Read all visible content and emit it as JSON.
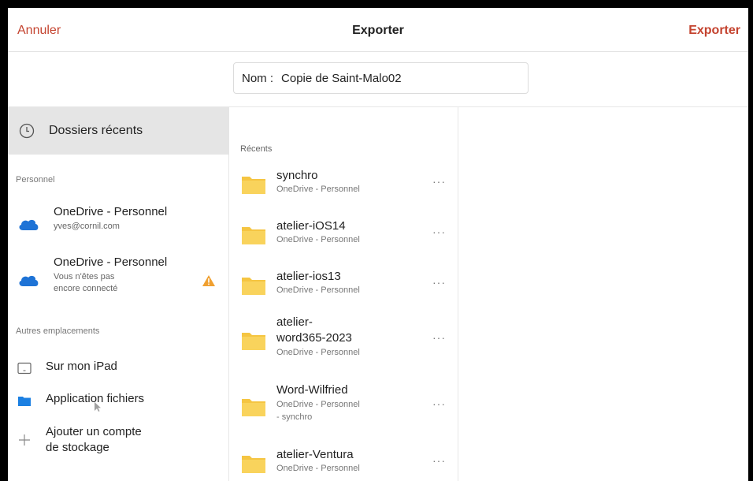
{
  "header": {
    "cancel_label": "Annuler",
    "title": "Exporter",
    "export_label": "Exporter"
  },
  "name_field": {
    "label": "Nom :",
    "value": "Copie de Saint-Malo02"
  },
  "sidebar": {
    "recent_label": "Dossiers récents",
    "personal_section": "Personnel",
    "accounts": [
      {
        "title": "OneDrive - Personnel",
        "subtitle": "yves@cornil.com",
        "icon": "onedrive-cloud-icon"
      },
      {
        "title": "OneDrive - Personnel",
        "subtitle_line1": "Vous n'êtes pas",
        "subtitle_line2": "encore connecté",
        "icon": "onedrive-cloud-icon",
        "warning_icon": "warning-icon"
      }
    ],
    "other_section": "Autres emplacements",
    "places": [
      {
        "label": "Sur mon iPad",
        "icon": "ipad-icon"
      },
      {
        "label": "Application fichiers",
        "icon": "folder-icon"
      },
      {
        "label_line1": "Ajouter un compte",
        "label_line2": "de stockage",
        "icon": "plus-icon"
      }
    ]
  },
  "recents": {
    "section_label": "Récents",
    "items": [
      {
        "name": "synchro",
        "location": "OneDrive - Personnel"
      },
      {
        "name": "atelier-iOS14",
        "location": "OneDrive - Personnel"
      },
      {
        "name": "atelier-ios13",
        "location": "OneDrive - Personnel"
      },
      {
        "name_line1": "atelier-",
        "name_line2": "word365-2023",
        "location": "OneDrive - Personnel"
      },
      {
        "name": "Word-Wilfried",
        "location_line1": "OneDrive - Personnel",
        "location_line2": "- synchro"
      },
      {
        "name": "atelier-Ventura",
        "location": "OneDrive - Personnel"
      }
    ],
    "more_label": "···"
  },
  "colors": {
    "accent": "#c4432f",
    "folder": "#f5c542",
    "onedrive": "#1e73d6",
    "warning": "#f0a030",
    "selected_bg": "#e5e5e5"
  }
}
